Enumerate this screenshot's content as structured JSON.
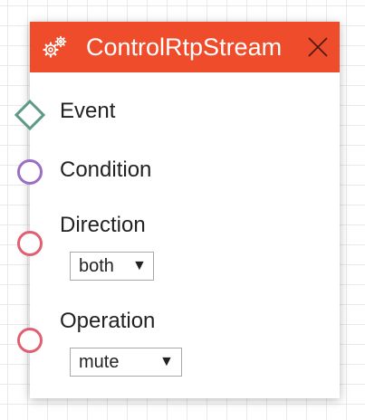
{
  "node": {
    "title": "ControlRtpStream",
    "icon": "gear-icon",
    "header_color": "#ee4c2a",
    "close_icon": "close-icon"
  },
  "ports": {
    "event": {
      "label": "Event",
      "shape": "diamond",
      "color": "#5b9a84"
    },
    "condition": {
      "label": "Condition",
      "shape": "circle",
      "color": "#9b6fc4"
    },
    "direction": {
      "label": "Direction",
      "shape": "circle",
      "color": "#e06070"
    },
    "operation": {
      "label": "Operation",
      "shape": "circle",
      "color": "#e06070"
    }
  },
  "fields": {
    "direction": {
      "value": "both",
      "arrow": "▼"
    },
    "operation": {
      "value": "mute",
      "arrow": "▼"
    }
  }
}
